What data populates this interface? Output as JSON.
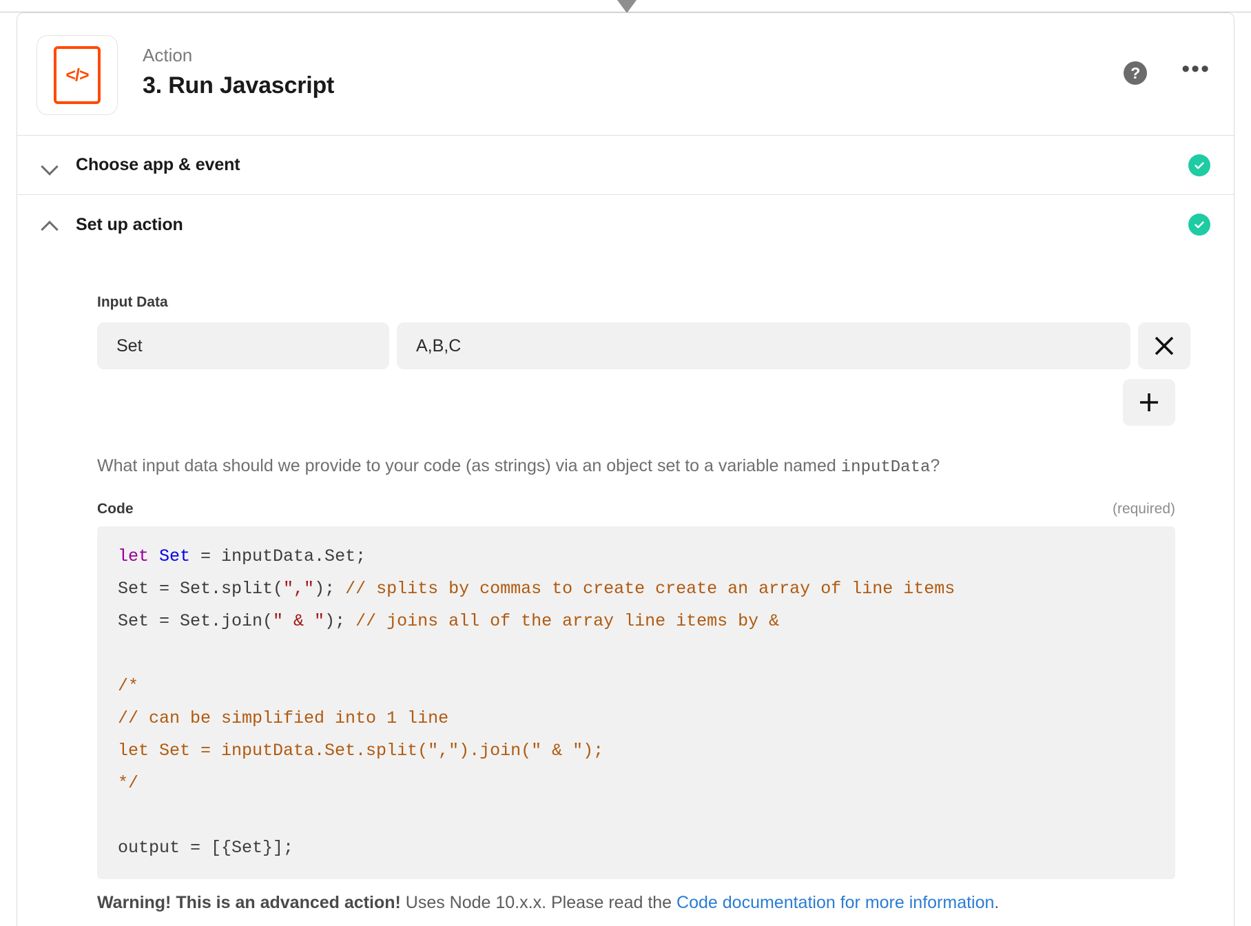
{
  "header": {
    "kicker": "Action",
    "title": "3. Run Javascript",
    "app_icon_glyph": "</>",
    "help_glyph": "?",
    "more_glyph": "•••"
  },
  "sections": [
    {
      "title": "Choose app & event",
      "state": "collapsed",
      "status": "complete"
    },
    {
      "title": "Set up action",
      "state": "expanded",
      "status": "complete"
    }
  ],
  "input_data": {
    "label": "Input Data",
    "key": "Set",
    "key_placeholder": "key",
    "value": "A,B,C",
    "value_placeholder": "value",
    "remove_label": "×",
    "add_label": "+"
  },
  "helper": {
    "part1": "What input data should we provide to your code (as strings) via an object set to a variable named ",
    "mono": "inputData",
    "part2": "?"
  },
  "code_field": {
    "label": "Code",
    "required": "(required)",
    "lines": [
      [
        {
          "t": "let ",
          "c": "kw"
        },
        {
          "t": "Set ",
          "c": "var"
        },
        {
          "t": "= inputData.Set;",
          "c": ""
        }
      ],
      [
        {
          "t": "Set = Set.split(",
          "c": ""
        },
        {
          "t": "\",\"",
          "c": "str"
        },
        {
          "t": "); ",
          "c": ""
        },
        {
          "t": "// splits by commas to create create an array of line items",
          "c": "com"
        }
      ],
      [
        {
          "t": "Set = Set.join(",
          "c": ""
        },
        {
          "t": "\" & \"",
          "c": "str"
        },
        {
          "t": "); ",
          "c": ""
        },
        {
          "t": "// joins all of the array line items by &",
          "c": "com"
        }
      ],
      [],
      [
        {
          "t": "/*",
          "c": "com"
        }
      ],
      [
        {
          "t": "// can be simplified into 1 line",
          "c": "com"
        }
      ],
      [
        {
          "t": "let Set = inputData.Set.split(\",\").join(\" & \");",
          "c": "com"
        }
      ],
      [
        {
          "t": "*/",
          "c": "com"
        }
      ],
      [],
      [
        {
          "t": "output = [{Set}];",
          "c": ""
        }
      ]
    ]
  },
  "warning": {
    "strong": "Warning! This is an advanced action!",
    "text": " Uses Node 10.x.x. Please read the ",
    "link": "Code documentation for more information",
    "tail": "."
  }
}
